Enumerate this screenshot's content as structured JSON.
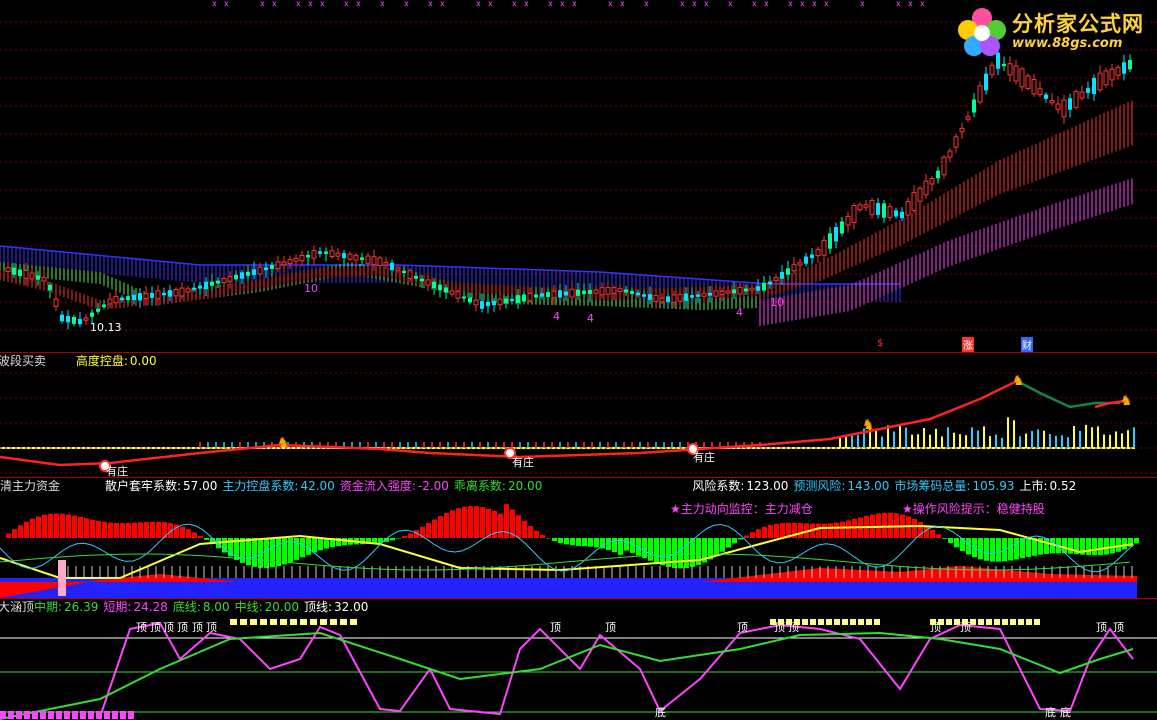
{
  "watermark": {
    "title": "分析家公式网",
    "url": "www.88gs.com"
  },
  "pane1": {
    "low_label": "10.13",
    "count_labels": [
      "10",
      "4",
      "4",
      "4",
      "10"
    ],
    "signals": [
      {
        "text": "$",
        "color": "#ff3030"
      },
      {
        "text": "涨",
        "color": "#ff3030"
      },
      {
        "text": "财",
        "color": "#3366ff"
      }
    ]
  },
  "pane2": {
    "title": "波段买卖",
    "label": "高度控盘:",
    "value": "0.00",
    "markers": [
      "有庄",
      "有庄",
      "有庄"
    ]
  },
  "pane3": {
    "title": "看清主力资金",
    "items": [
      {
        "label": "散户套牢系数:",
        "value": "57.00",
        "color": "#ffffff"
      },
      {
        "label": "主力控盘系数:",
        "value": "42.00",
        "color": "#33c8ff"
      },
      {
        "label": "资金流入强度:",
        "value": "-2.00",
        "color": "#ff44ff"
      },
      {
        "label": "乖离系数:",
        "value": "20.00",
        "color": "#33dd33"
      },
      {
        "label": "风险系数:",
        "value": "123.00",
        "color": "#ffffff"
      },
      {
        "label": "预测风险:",
        "value": "143.00",
        "color": "#33c8ff"
      },
      {
        "label": "市场筹码总量:",
        "value": "105.93",
        "color": "#33c8ff"
      },
      {
        "label": "上市:",
        "value": "0.52",
        "color": "#ffffff"
      }
    ],
    "notes": [
      "★主力动向监控：主力减仓",
      "★操作风险提示：稳健持股"
    ]
  },
  "pane4": {
    "title": "大涵顶",
    "items": [
      {
        "label": "中期:",
        "value": "26.39",
        "color": "#33dd33"
      },
      {
        "label": "短期:",
        "value": "24.28",
        "color": "#ff44ff"
      },
      {
        "label": "底线:",
        "value": "8.00",
        "color": "#33dd33"
      },
      {
        "label": "中线:",
        "value": "20.00",
        "color": "#33dd33"
      },
      {
        "label": "顶线:",
        "value": "32.00",
        "color": "#ffffff"
      }
    ],
    "top_mark": "顶",
    "bottom_mark": "底"
  },
  "colors": {
    "up": "#ff3333",
    "down": "#00e5ff",
    "ma_blue": "#3333ff",
    "ma_green": "#55ee55",
    "band_red": "#ff3333",
    "band_pink": "#ff44ff",
    "yellow": "#ffff33"
  }
}
